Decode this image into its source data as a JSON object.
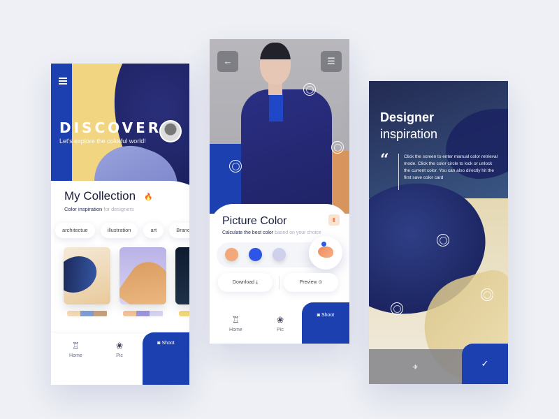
{
  "screen1": {
    "hero": {
      "title": "DISCOVER",
      "subtitle": "Let's explore the colorful world!"
    },
    "collection": {
      "title": "My Collection",
      "subtitle": "Color inspiration",
      "subtitle_light": "for designers"
    },
    "chips": [
      "architectue",
      "illustration",
      "art",
      "Branding"
    ],
    "cards": [
      {
        "palette": [
          "#f6d9b6",
          "#7ea0d6",
          "#c8a27c"
        ]
      },
      {
        "palette": [
          "#f4c49b",
          "#9d97e0",
          "#d7d5f0"
        ]
      },
      {
        "palette": [
          "#f4d97a",
          "#ffffff",
          "#f4d97a"
        ]
      }
    ],
    "tabs": {
      "home": "Home",
      "pic": "Pic",
      "shoot": "Shoot"
    }
  },
  "screen2": {
    "title": "Picture Color",
    "subtitle": "Calculate the best color",
    "subtitle_light": "based on your choice",
    "swatches": [
      "#f2a87a",
      "#2d55e6",
      "#cfd0ec"
    ],
    "download_label": "Download",
    "preview_label": "Preview",
    "tabs": {
      "home": "Home",
      "pic": "Pic",
      "shoot": "Shoot"
    }
  },
  "screen3": {
    "heading_bold": "Designer",
    "heading_light": "inspiration",
    "quote_mark": "“",
    "description": "Click the screen to enter manual color retrieval mode. Click the color circle to lock or unlock the current color. You can also directly hit the first save color card"
  },
  "colors": {
    "accent_blue": "#1d40b0",
    "accent_orange": "#f08b5a",
    "background": "#eef0f5"
  }
}
